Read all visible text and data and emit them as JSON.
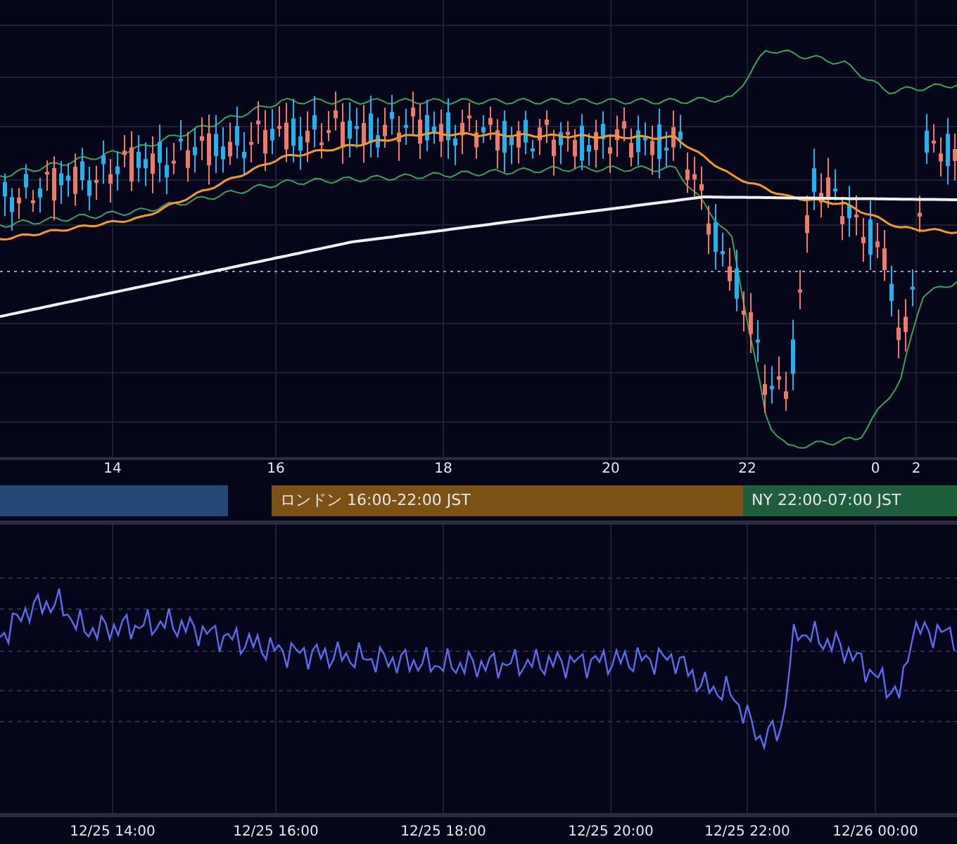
{
  "price_chart": {
    "hour_ticks": [
      "14",
      "16",
      "18",
      "20",
      "22",
      "0",
      "2"
    ]
  },
  "sessions": [
    {
      "color": "#234a74"
    },
    {
      "label": "ロンドン 16:00-22:00 JST",
      "color": "#7a5216"
    },
    {
      "label": "NY 22:00-07:00 JST",
      "color": "#1f5e3c"
    }
  ],
  "time_axis": [
    "12/25 14:00",
    "12/25 16:00",
    "12/25 18:00",
    "12/25 20:00",
    "12/25 22:00",
    "12/26 00:00"
  ]
}
